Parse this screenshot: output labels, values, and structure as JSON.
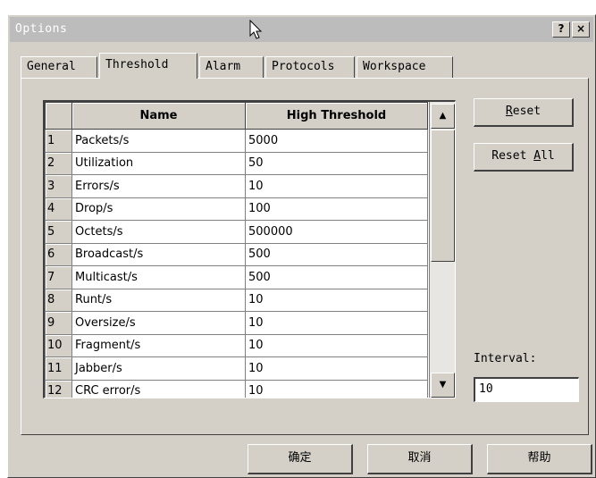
{
  "window": {
    "title": "Options",
    "help_button": "?",
    "close_button": "×"
  },
  "tabs": [
    {
      "label": "General",
      "active": false
    },
    {
      "label": "Threshold",
      "active": true
    },
    {
      "label": "Alarm",
      "active": false
    },
    {
      "label": "Protocols",
      "active": false
    },
    {
      "label": "Workspace",
      "active": false
    }
  ],
  "grid": {
    "columns": [
      "Name",
      "High Threshold"
    ],
    "rows": [
      {
        "num": "1",
        "name": "Packets/s",
        "value": "5000"
      },
      {
        "num": "2",
        "name": "Utilization",
        "value": "50"
      },
      {
        "num": "3",
        "name": "Errors/s",
        "value": "10"
      },
      {
        "num": "4",
        "name": "Drop/s",
        "value": "100"
      },
      {
        "num": "5",
        "name": "Octets/s",
        "value": "500000"
      },
      {
        "num": "6",
        "name": "Broadcast/s",
        "value": "500"
      },
      {
        "num": "7",
        "name": "Multicast/s",
        "value": "500"
      },
      {
        "num": "8",
        "name": "Runt/s",
        "value": "10"
      },
      {
        "num": "9",
        "name": "Oversize/s",
        "value": "10"
      },
      {
        "num": "10",
        "name": "Fragment/s",
        "value": "10"
      },
      {
        "num": "11",
        "name": "Jabber/s",
        "value": "10"
      },
      {
        "num": "12",
        "name": "CRC error/s",
        "value": "10"
      }
    ],
    "scroll_up": "▲",
    "scroll_down": "▼"
  },
  "side": {
    "reset_first": "R",
    "reset_rest": "eset",
    "reset_all_prefix": "Reset ",
    "reset_all_first": "A",
    "reset_all_rest": "ll",
    "interval_label": "Interval:",
    "interval_value": "10"
  },
  "footer": {
    "ok": "确定",
    "cancel": "取消",
    "help": "帮助"
  }
}
